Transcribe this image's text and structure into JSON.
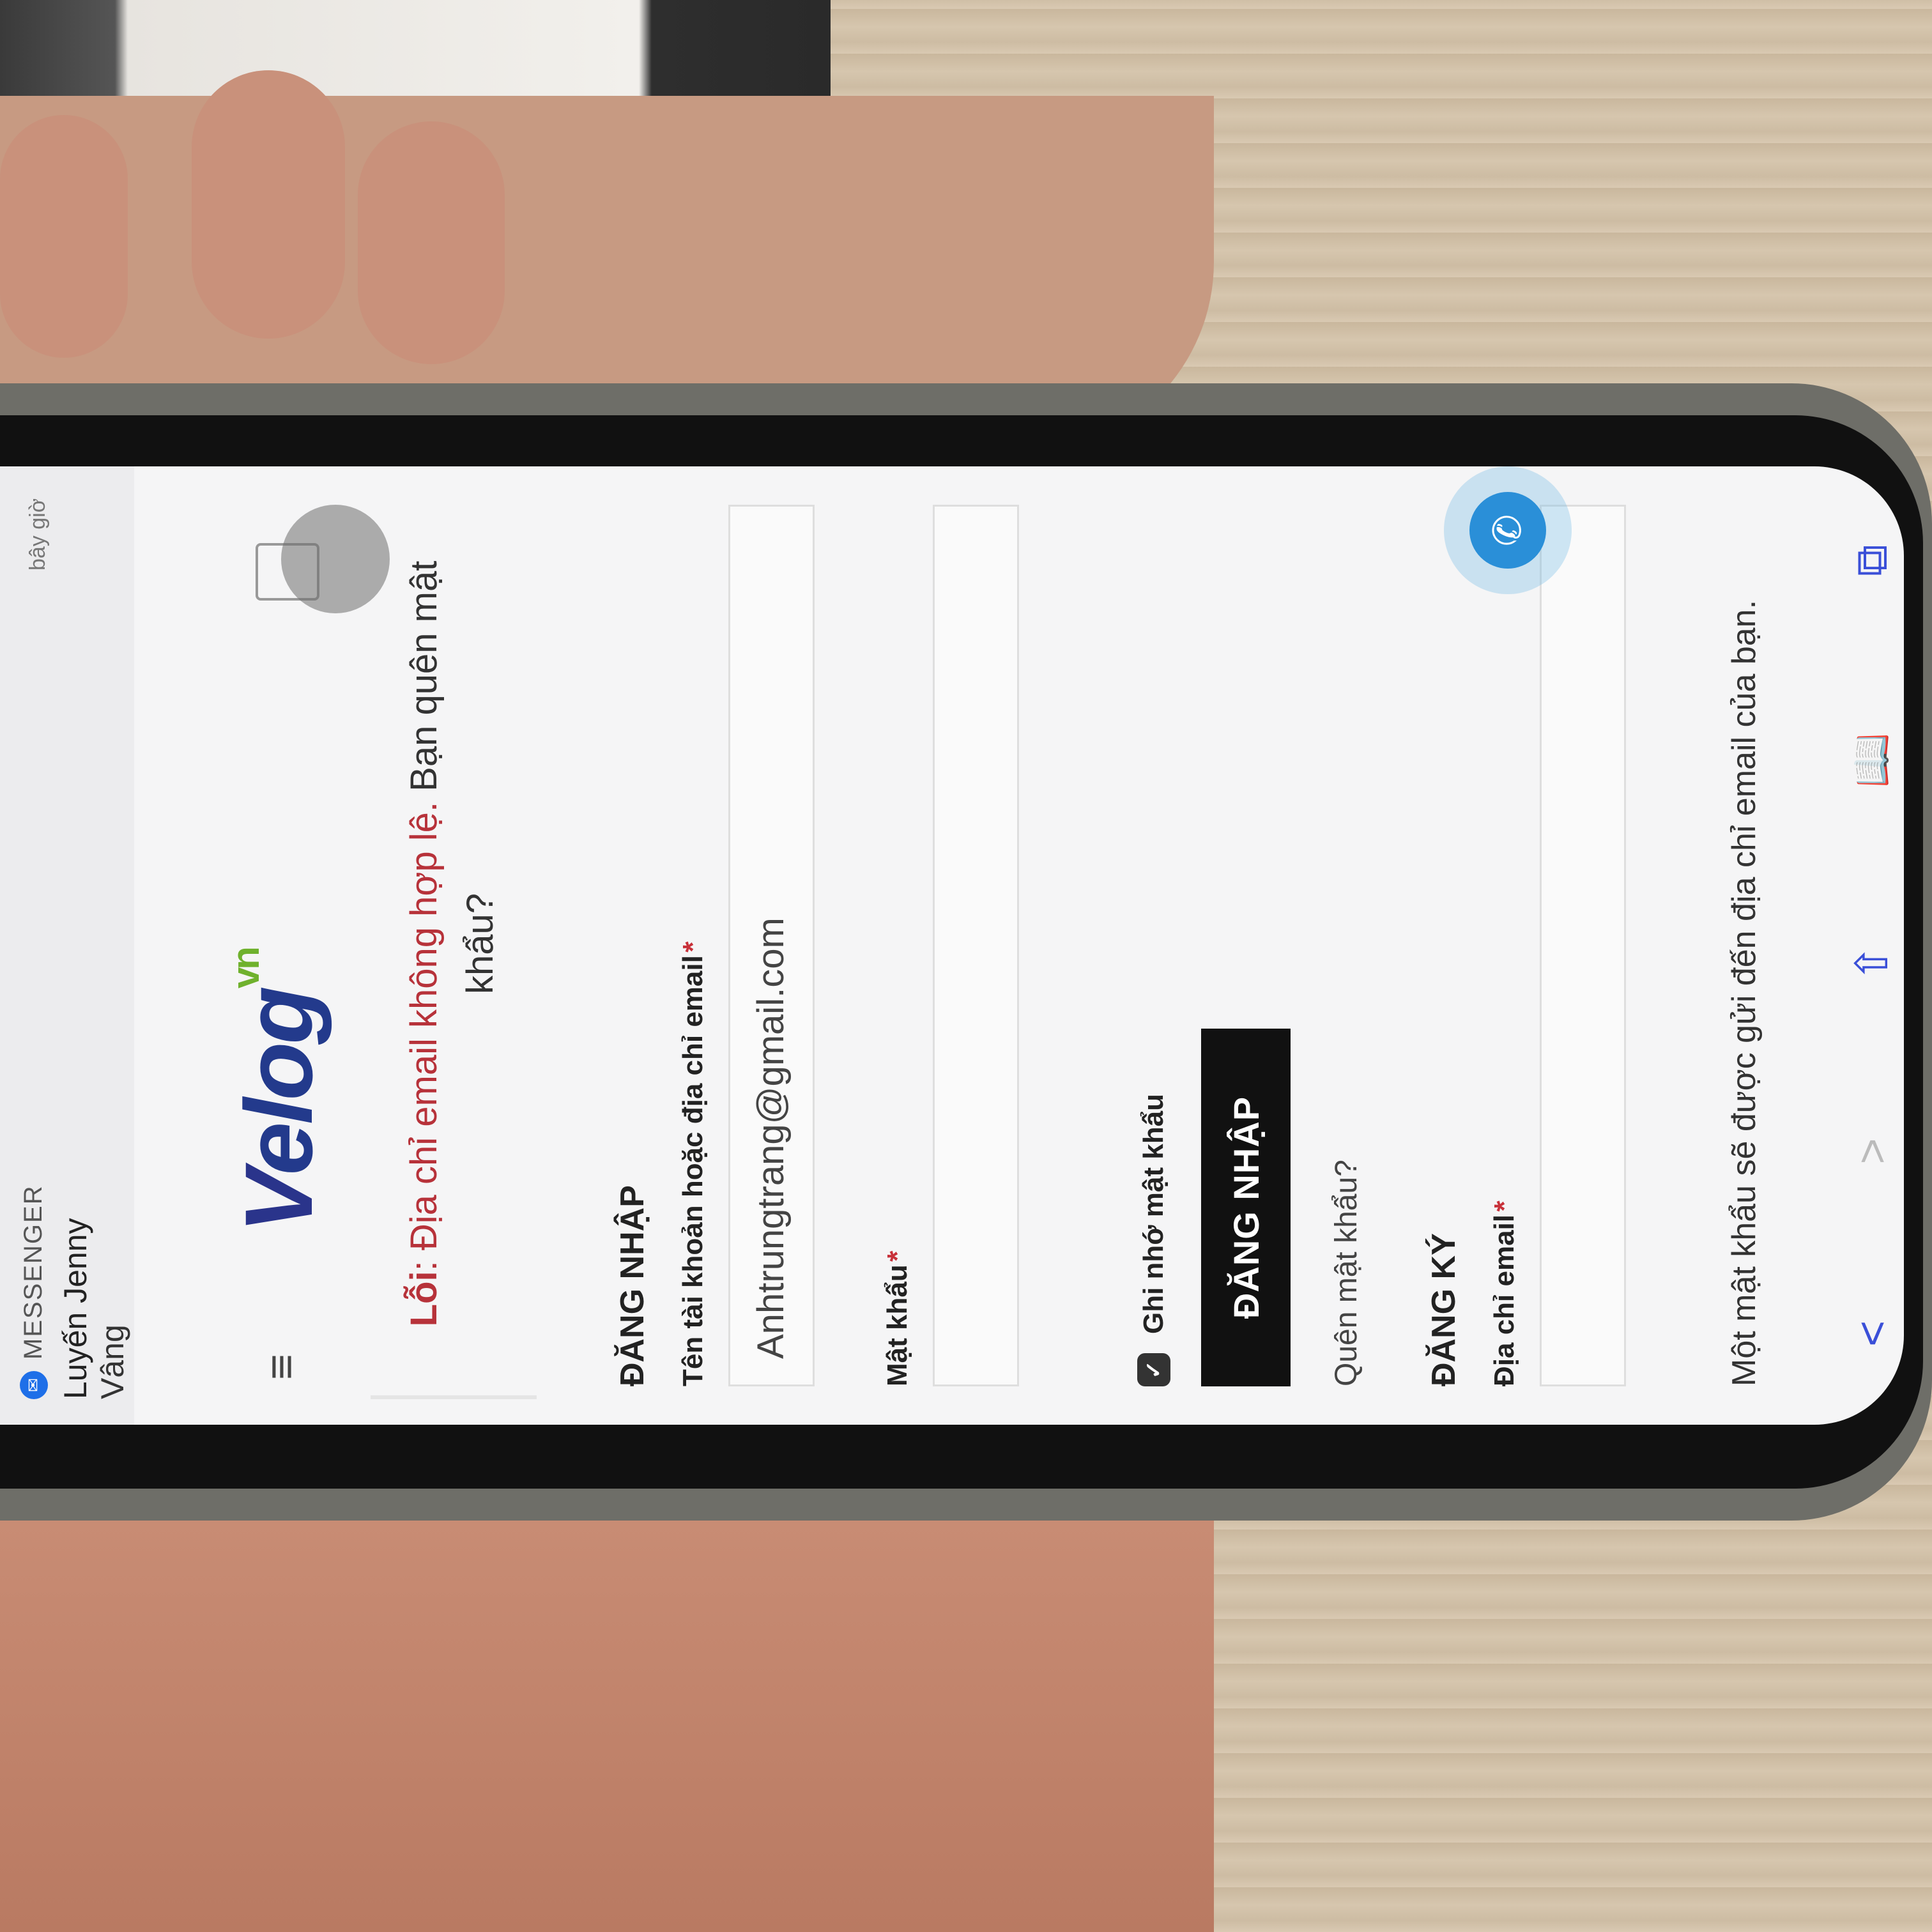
{
  "notification": {
    "app_icon": "messenger-icon",
    "app_name": "MESSENGER",
    "time": "bây giờ",
    "sender": "Luyến Jenny",
    "message": "Vâng"
  },
  "header": {
    "logo_main": "elog",
    "logo_v": "V",
    "logo_suffix": "vn",
    "menu_icon": "hamburger-icon",
    "cart_icon": "cart-icon"
  },
  "error": {
    "prefix": "Lỗi",
    "text": ": Địa chỉ email không hợp lệ. ",
    "link": "Bạn quên mật khẩu?"
  },
  "login": {
    "heading": "ĐĂNG NHẬP",
    "username_label": "Tên tài khoản hoặc địa chỉ email",
    "username_value": "Anhtrungtrang@gmail.com",
    "password_label": "Mật khẩu",
    "password_value": "",
    "remember_label": "Ghi nhớ mật khẩu",
    "submit_label": "ĐĂNG NHẬP",
    "forgot_label": "Quên mật khẩu?",
    "required_mark": "*"
  },
  "register": {
    "heading": "ĐĂNG KÝ",
    "email_label": "Địa chỉ email",
    "email_value": "",
    "note": "Một mật khẩu sẽ được gửi đến địa chỉ email của bạn."
  },
  "toolbar": {
    "back": "<",
    "forward": ">",
    "share": "⇧",
    "bookmarks": "📖",
    "tabs": "⧉"
  },
  "colors": {
    "error_red": "#b7323a",
    "logo_blue": "#233a8c",
    "logo_green": "#6fb12d",
    "toolbar_blue": "#3a4fd8",
    "call_blue": "#2a8fd8"
  }
}
